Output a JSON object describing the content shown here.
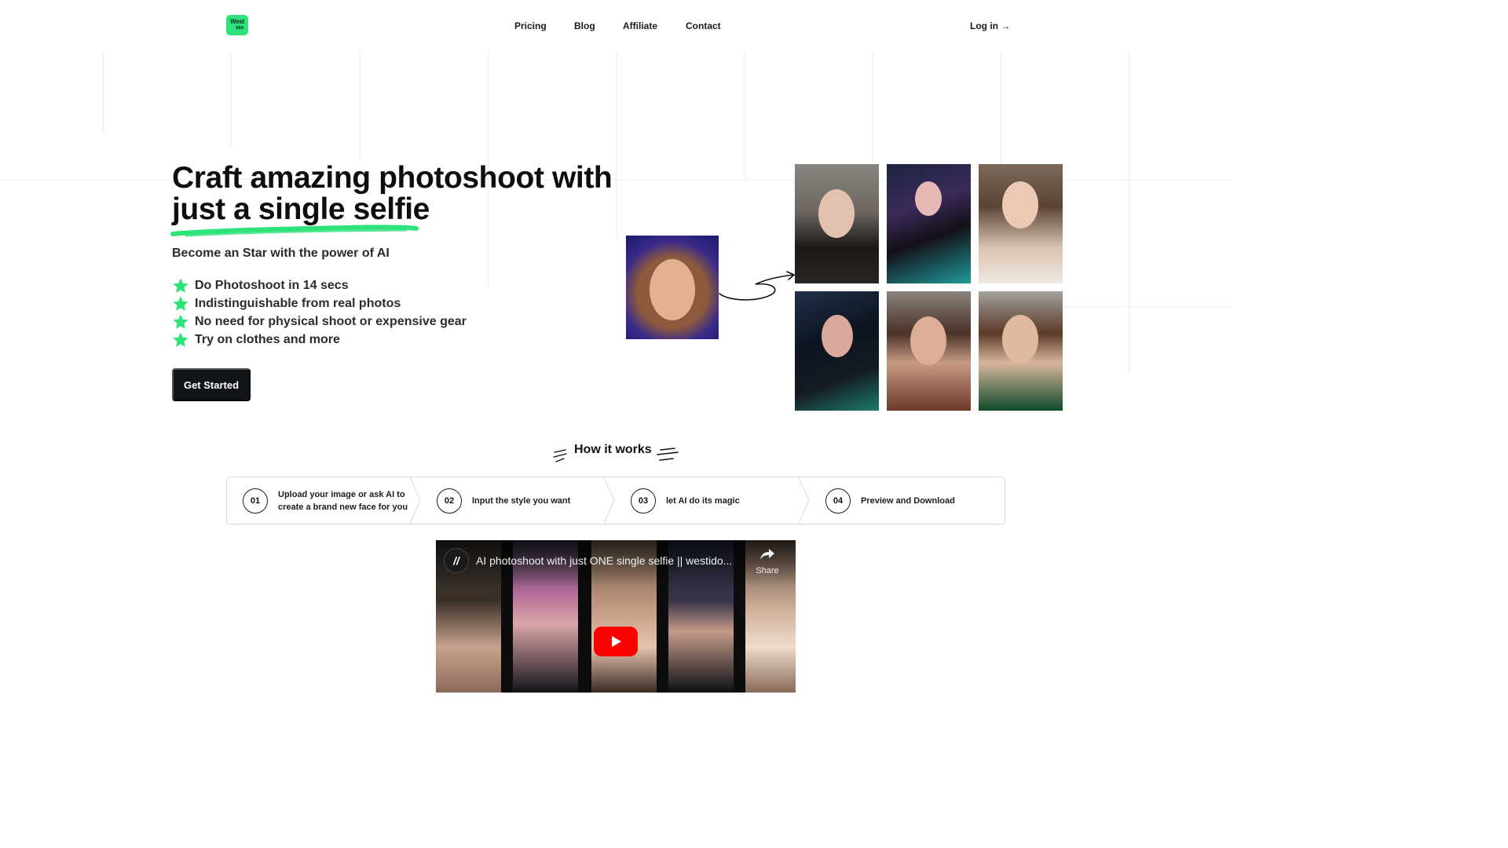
{
  "header": {
    "logo_line1": "West",
    "logo_line2": "Idol",
    "nav": [
      "Pricing",
      "Blog",
      "Affiliate",
      "Contact"
    ],
    "login": "Log in →"
  },
  "hero": {
    "title_line1": "Craft amazing photoshoot with",
    "title_line2": "just a single selfie",
    "subtitle": "Become an Star with the power of AI",
    "features": [
      "Do Photoshoot in 14 secs",
      "Indistinguishable from real photos",
      "No need for physical shoot or expensive gear",
      "Try on clothes and more"
    ],
    "cta": "Get Started"
  },
  "how_it_works": {
    "title": "How it works",
    "steps": [
      {
        "num": "01",
        "text": "Upload your image or ask AI to create a brand new face for you"
      },
      {
        "num": "02",
        "text": "Input the style you want"
      },
      {
        "num": "03",
        "text": "let AI do its magic"
      },
      {
        "num": "04",
        "text": "Preview and Download"
      }
    ]
  },
  "video": {
    "title": "AI photoshoot with just ONE single selfie || westido...",
    "share_label": "Share"
  },
  "colors": {
    "accent_green": "#2fe37b",
    "cta_bg": "#111418",
    "youtube_red": "#ff0000"
  },
  "icons": {
    "feature_bullet": "green-star-icon",
    "play": "play-icon",
    "share": "share-arrow-icon"
  }
}
